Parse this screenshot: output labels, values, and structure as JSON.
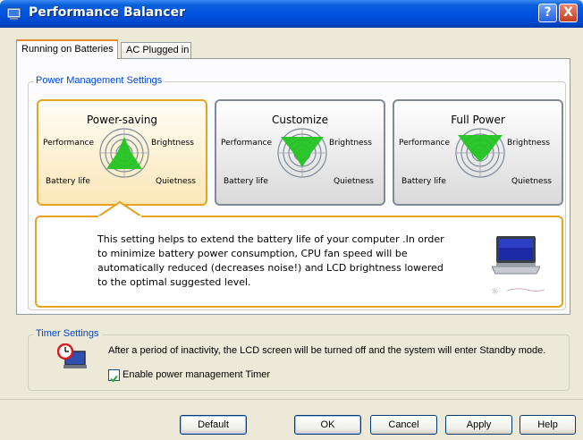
{
  "window": {
    "title": "Performance Balancer",
    "help_button": "?",
    "close_button": "X"
  },
  "tabs": [
    {
      "label": "Running on Batteries",
      "active": true
    },
    {
      "label": "AC Plugged in",
      "active": false
    }
  ],
  "power_management": {
    "legend": "Power Management Settings",
    "modes": [
      {
        "title": "Power-saving",
        "selected": true,
        "labels": {
          "tl": "Performance",
          "tr": "Brightness",
          "bl": "Battery life",
          "br": "Quietness"
        }
      },
      {
        "title": "Customize",
        "selected": false,
        "labels": {
          "tl": "Performance",
          "tr": "Brightness",
          "bl": "Battery life",
          "br": "Quietness"
        }
      },
      {
        "title": "Full Power",
        "selected": false,
        "labels": {
          "tl": "Performance",
          "tr": "Brightness",
          "bl": "Battery life",
          "br": "Quietness"
        }
      }
    ],
    "description_lines": [
      "This setting helps to extend the battery life of your computer .In order",
      "to minimize battery power consumption, CPU fan speed will be",
      "automatically reduced (decreases noise!) and LCD brightness lowered",
      "to the optimal suggested level."
    ]
  },
  "timer": {
    "legend": "Timer Settings",
    "description": "After a period of inactivity, the LCD screen will be turned off and the system will enter Standby mode.",
    "checkbox_label": "Enable power management Timer",
    "checked": true
  },
  "buttons": {
    "default": "Default",
    "ok": "OK",
    "cancel": "Cancel",
    "apply": "Apply",
    "help": "Help"
  },
  "colors": {
    "titlebar": "#0054e3",
    "selected_border": "#e6a422",
    "legend_text": "#0046d5",
    "radar_fill": "#22c322"
  }
}
